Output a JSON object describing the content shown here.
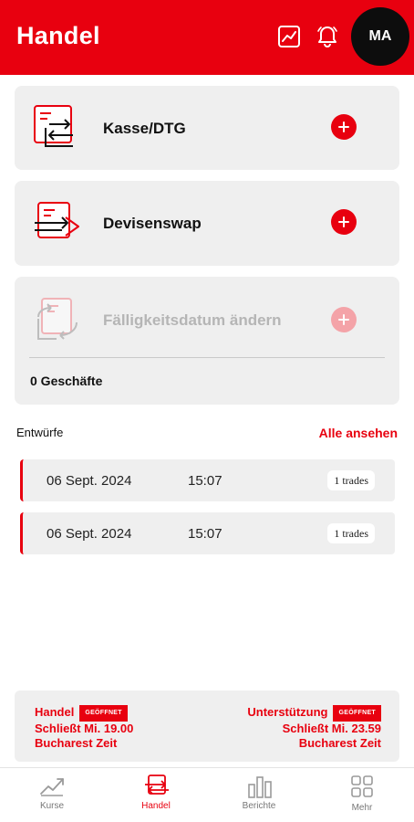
{
  "header": {
    "title": "Handel",
    "avatar_initials": "MA",
    "icons": [
      "chart-icon",
      "bell-icon"
    ]
  },
  "trade_types": [
    {
      "label": "Kasse/DTG",
      "icon": "spot-trade-icon",
      "enabled": true
    },
    {
      "label": "Devisenswap",
      "icon": "fx-swap-icon",
      "enabled": true
    },
    {
      "label": "Fälligkeitsdatum ändern",
      "icon": "change-maturity-icon",
      "enabled": false,
      "count_label": "0 Geschäfte"
    }
  ],
  "drafts": {
    "title": "Entwürfe",
    "view_all": "Alle ansehen",
    "items": [
      {
        "date": "06 Sept. 2024",
        "time": "15:07",
        "badge": "1 trades"
      },
      {
        "date": "06 Sept. 2024",
        "time": "15:07",
        "badge": "1 trades"
      }
    ]
  },
  "hours": {
    "trading": {
      "title": "Handel",
      "status": "GEÖFFNET",
      "line1": "Schließt Mi. 19.00",
      "line2": "Bucharest Zeit"
    },
    "support": {
      "title": "Unterstützung",
      "status": "GEÖFFNET",
      "line1": "Schließt Mi. 23.59",
      "line2": "Bucharest Zeit"
    }
  },
  "nav": {
    "active": "Handel",
    "items": [
      {
        "label": "Kurse",
        "icon": "rates-icon"
      },
      {
        "label": "Handel",
        "icon": "trade-icon"
      },
      {
        "label": "Berichte",
        "icon": "reports-icon"
      },
      {
        "label": "Mehr",
        "icon": "more-grid-icon"
      }
    ]
  },
  "colors": {
    "brand_red": "#e8000f",
    "card_bg": "#efefef",
    "disabled_red": "#f4a3a8"
  }
}
